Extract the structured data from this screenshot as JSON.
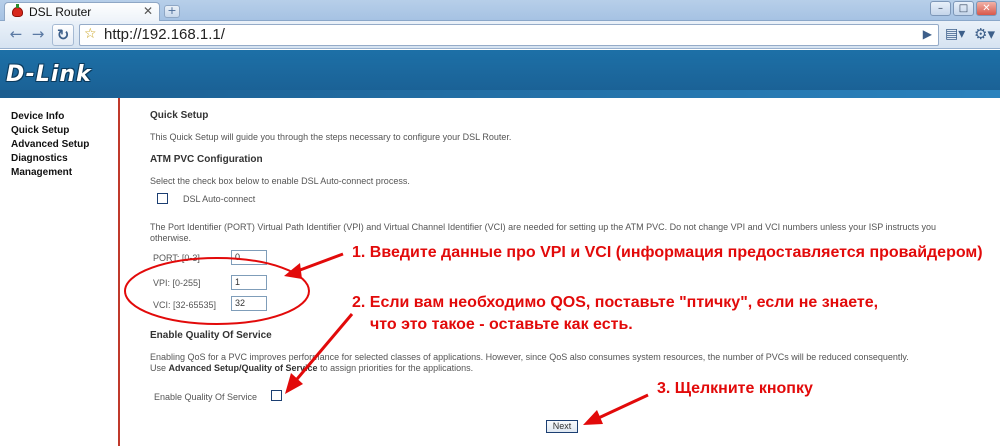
{
  "browser": {
    "tab_title": "DSL Router",
    "tab_close": "✕",
    "new_tab": "+",
    "url": "http://192.168.1.1/",
    "window_buttons": {
      "minimize": "–",
      "maximize": "□",
      "close": "✕"
    }
  },
  "header": {
    "brand": "D-Link"
  },
  "sidebar": {
    "items": [
      {
        "label": "Device Info"
      },
      {
        "label": "Quick Setup"
      },
      {
        "label": "Advanced Setup"
      },
      {
        "label": "Diagnostics"
      },
      {
        "label": "Management"
      }
    ]
  },
  "main": {
    "title": "Quick Setup",
    "intro": "This Quick Setup will guide you through the steps necessary to configure your DSL Router.",
    "atm_heading": "ATM PVC Configuration",
    "autoconnect_hint": "Select the check box below to enable DSL Auto-connect process.",
    "autoconnect_label": "DSL Auto-connect",
    "autoconnect_checked": false,
    "pvc_help": "The Port Identifier (PORT) Virtual Path Identifier (VPI) and Virtual Channel Identifier (VCI) are needed for setting up the ATM PVC. Do not change VPI and VCI numbers unless your ISP instructs you otherwise.",
    "port_label": "PORT: [0-3]",
    "port_value": "0",
    "vpi_label": "VPI: [0-255]",
    "vpi_value": "1",
    "vci_label": "VCI: [32-65535]",
    "vci_value": "32",
    "qos_heading": "Enable Quality Of Service",
    "qos_help_1": "Enabling QoS for a PVC improves performance for selected classes of applications. However, since QoS also consumes system resources, the number of PVCs will be reduced consequently.",
    "qos_help_2_pre": "Use ",
    "qos_help_2_bold": "Advanced Setup/Quality of Service",
    "qos_help_2_post": " to assign priorities for the applications.",
    "qos_label": "Enable Quality Of Service",
    "qos_checked": false,
    "next_button": "Next"
  },
  "annotations": {
    "note1": "1. Введите данные про VPI и VCI (информация предоставляется провайдером)",
    "note2_line1": "2. Если вам необходимо QOS, поставьте \"птичку\", если не знаете,",
    "note2_line2": "что это такое - оставьте как есть.",
    "note3": "3. Щелкните кнопку",
    "color": "#e20a0a"
  }
}
